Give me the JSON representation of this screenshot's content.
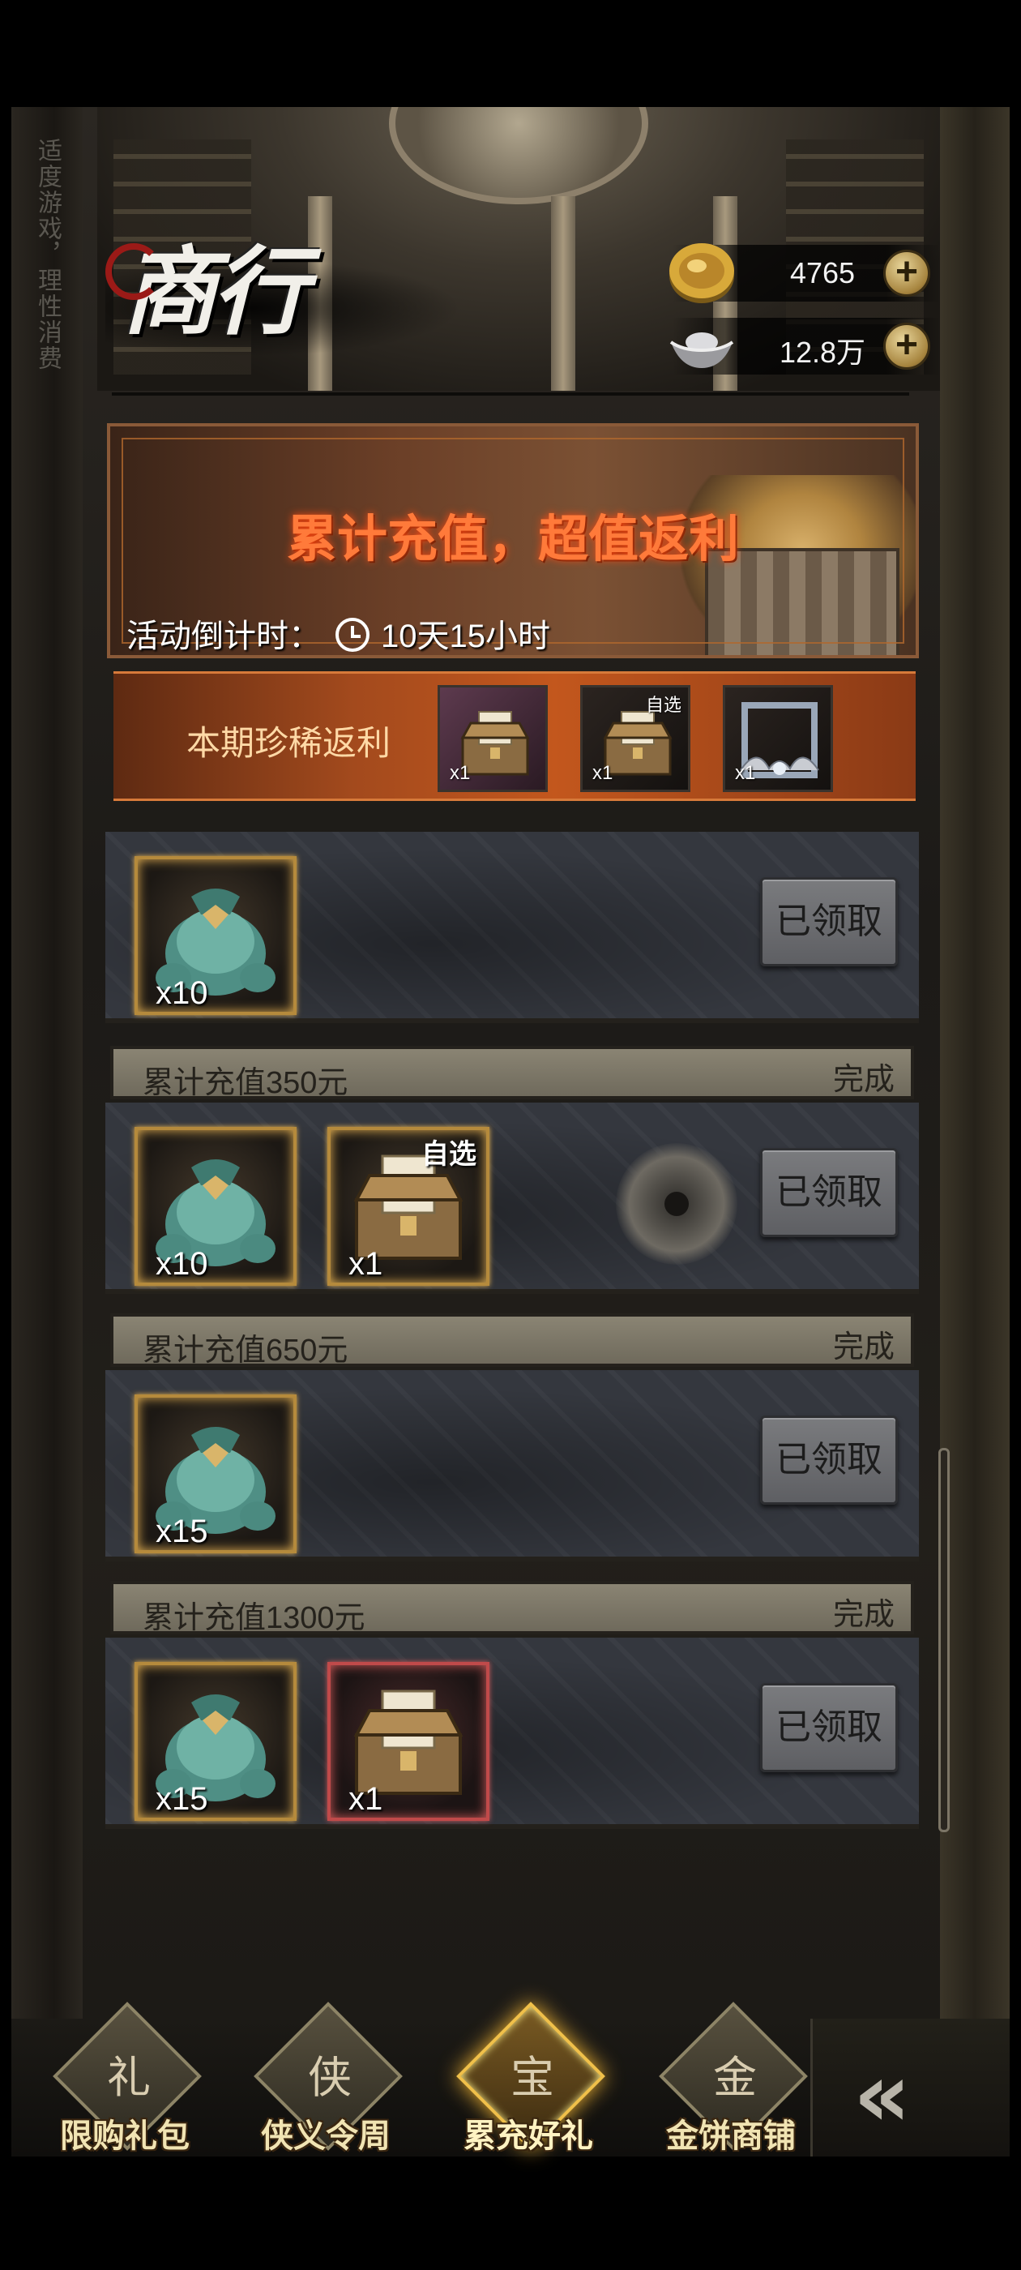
{
  "side_slogan": "适度游戏，理性消费",
  "header": {
    "title": "商行",
    "gold": {
      "icon": "gold-coin-icon",
      "amount": "4765"
    },
    "silver": {
      "icon": "silver-ingot-icon",
      "amount": "12.8万"
    },
    "add_symbol": "+"
  },
  "banner": {
    "headline": "累计充值，超值返利",
    "countdown_label": "活动倒计时：",
    "countdown_value": "10天15小时"
  },
  "rare_rewards": {
    "label": "本期珍稀返利",
    "items": [
      {
        "icon": "treasure-chest-icon",
        "qty": "x1",
        "tag": ""
      },
      {
        "icon": "treasure-chest-select-icon",
        "qty": "x1",
        "tag": "自选"
      },
      {
        "icon": "avatar-frame-icon",
        "qty": "x1",
        "tag": ""
      }
    ]
  },
  "tiers": [
    {
      "name": "",
      "status": "",
      "items": [
        {
          "icon": "jade-bag-icon",
          "qty": "x10",
          "tag": ""
        }
      ],
      "button": "已领取"
    },
    {
      "name": "累计充值350元",
      "status": "完成",
      "items": [
        {
          "icon": "jade-bag-icon",
          "qty": "x10",
          "tag": ""
        },
        {
          "icon": "treasure-chest-select-icon",
          "qty": "x1",
          "tag": "自选"
        }
      ],
      "button": "已领取"
    },
    {
      "name": "累计充值650元",
      "status": "完成",
      "items": [
        {
          "icon": "jade-bag-icon",
          "qty": "x15",
          "tag": ""
        }
      ],
      "button": "已领取"
    },
    {
      "name": "累计充值1300元",
      "status": "完成",
      "items": [
        {
          "icon": "jade-bag-icon",
          "qty": "x15",
          "tag": ""
        },
        {
          "icon": "treasure-chest-icon",
          "qty": "x1",
          "tag": ""
        }
      ],
      "button": "已领取"
    }
  ],
  "bottom_nav": [
    {
      "label": "限购礼包",
      "glyph": "礼",
      "active": false
    },
    {
      "label": "侠义令周",
      "glyph": "侠",
      "active": false
    },
    {
      "label": "累充好礼",
      "glyph": "宝",
      "active": true
    },
    {
      "label": "金饼商铺",
      "glyph": "金",
      "active": false
    }
  ],
  "colors": {
    "accent_orange": "#ff7a3a",
    "rare_strip": "#c3571d",
    "gold_frame": "#b58a3c",
    "red_frame": "#c04a4a",
    "nav_active_glow": "#f3b635"
  }
}
